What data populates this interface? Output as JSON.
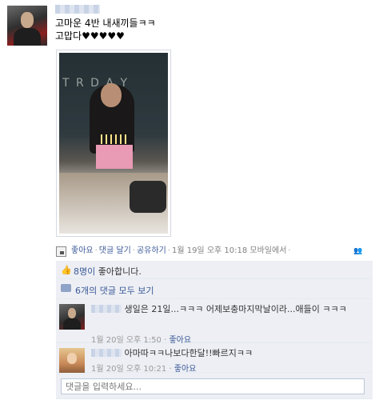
{
  "post": {
    "author_name": "",
    "text_line1": "고마운 4반 내새끼들ㅋㅋ",
    "text_line2": "고맙다♥♥♥♥♥",
    "photo": {
      "board_text": "T R D A Y"
    }
  },
  "actions": {
    "like": "좋아요",
    "comment": "댓글 달기",
    "share": "공유하기",
    "timestamp": "1월 19일 오후 10:18",
    "via": "모바일에서",
    "separator": "·"
  },
  "likes": {
    "count_text": "8명이",
    "suffix_text": " 좋아합니다."
  },
  "view_all": {
    "label": "6개의 댓글 모두 보기"
  },
  "comments": [
    {
      "author": "",
      "text": "생일은 21일...ㅋㅋㅋ 어제보충마지막날이라...애들이 ㅋㅋㅋ",
      "timestamp": "1월 20일 오후 1:50",
      "like_label": "좋아요"
    },
    {
      "author": "",
      "text": "아마따ㅋㅋ나보다한달!!빠르지ㅋㅋ",
      "timestamp": "1월 20일 오후 10:21",
      "like_label": "좋아요"
    }
  ],
  "write_comment": {
    "placeholder": "댓글을 입력하세요..."
  },
  "colors": {
    "link": "#3b5998",
    "ufi_background": "#edeff4",
    "meta_gray": "#999999"
  }
}
